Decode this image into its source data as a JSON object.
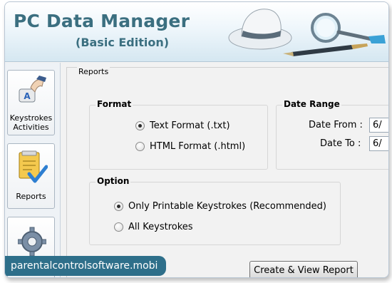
{
  "header": {
    "title": "PC Data Manager",
    "subtitle": "(Basic Edition)"
  },
  "sidebar": {
    "items": [
      {
        "label_line1": "Keystrokes",
        "label_line2": "Activities",
        "icon": "keyboard-hand-icon"
      },
      {
        "label_line1": "Reports",
        "label_line2": "",
        "icon": "report-checkmark-icon"
      },
      {
        "label_line1": "",
        "label_line2": "",
        "icon": "gear-icon"
      }
    ]
  },
  "reports": {
    "legend": "Reports",
    "format": {
      "title": "Format",
      "options": [
        {
          "label": "Text Format (.txt)",
          "checked": true
        },
        {
          "label": "HTML Format (.html)",
          "checked": false
        }
      ]
    },
    "date_range": {
      "title": "Date Range",
      "from_label": "Date From :",
      "from_value": "6/",
      "to_label": "Date To :",
      "to_value": "6/"
    },
    "option": {
      "title": "Option",
      "options": [
        {
          "label": "Only Printable Keystrokes (Recommended)",
          "checked": true
        },
        {
          "label": "All Keystrokes",
          "checked": false
        }
      ]
    },
    "create_button": "Create & View Report"
  },
  "watermark": "parentalcontrolsoftware.mobi",
  "colors": {
    "title": "#3b6f80",
    "watermark_bg": "#2e6f8a"
  }
}
